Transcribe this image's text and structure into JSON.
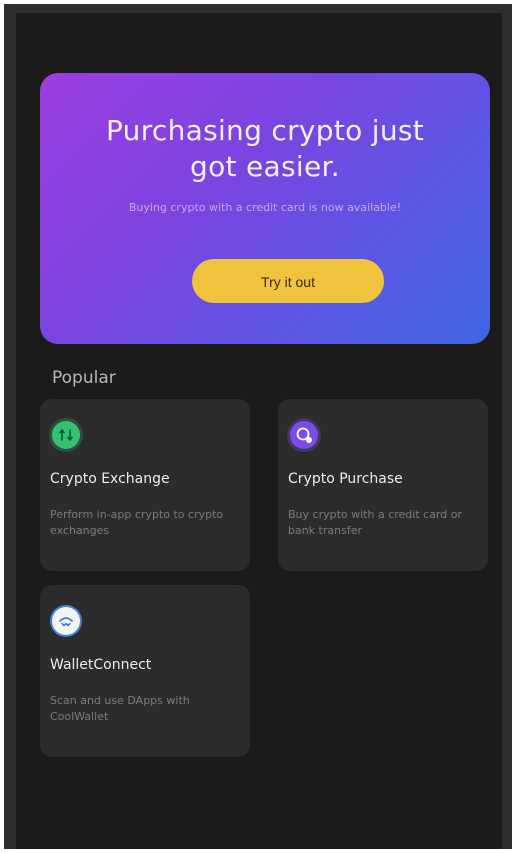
{
  "hero": {
    "title": "Purchasing crypto just got easier.",
    "subtitle": "Buying crypto with a credit card is now available!",
    "button_label": "Try it out",
    "gradient_start": "#9b3de0",
    "gradient_end": "#3f66e2",
    "button_color": "#f0c33c"
  },
  "popular": {
    "title": "Popular",
    "cards": [
      {
        "icon": "exchange-icon",
        "icon_color": "#34c173",
        "title": "Crypto Exchange",
        "description": "Perform in-app crypto to crypto exchanges"
      },
      {
        "icon": "purchase-icon",
        "icon_color": "#7b4be8",
        "title": "Crypto Purchase",
        "description": "Buy crypto with a credit card or bank transfer"
      },
      {
        "icon": "walletconnect-icon",
        "icon_color": "#3f83d9",
        "title": "WalletConnect",
        "description": "Scan and use DApps with CoolWallet"
      }
    ]
  }
}
